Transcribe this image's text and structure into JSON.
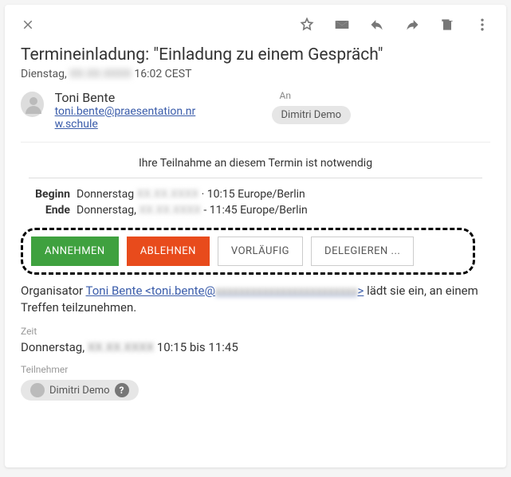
{
  "subject": "Termineinladung: \"Einladung zu einem Gespräch\"",
  "date_prefix": "Dienstag, ",
  "date_hidden": "XX.XX.XXXX",
  "date_suffix": " 16:02 CEST",
  "sender": {
    "name": "Toni Bente",
    "email": "toni.bente@prae­sentation.nrw.schule"
  },
  "to_label": "An",
  "recipient": "Dimitri Demo",
  "participation_note": "Ihre Teilnahme an diesem Termin ist notwendig",
  "times": {
    "begin_label": "Beginn",
    "begin_prefix": "Donnerstag ",
    "begin_hidden": "XX.XX.XXXX",
    "begin_suffix": " · 10:15 Europe/Berlin",
    "end_label": "Ende",
    "end_prefix": "Donnerstag, ",
    "end_hidden": "XX.XX.XXXX",
    "end_suffix": " - 11:45 Europe/Berlin"
  },
  "actions": {
    "accept": "ANNEHMEN",
    "decline": "ABLEHNEN",
    "tentative": "VORLÄUFIG",
    "delegate": "DELEGIEREN ..."
  },
  "organizer": {
    "prefix": "Organisator ",
    "link_text": "Toni Bente <toni.bente@",
    "link_hidden": "xxxxxxxxxxxxxxxxxxxxxxxx",
    "link_end": ">",
    "suffix": " lädt sie ein, an einem Treffen teilzunehmen."
  },
  "section_time_label": "Zeit",
  "time_detail_prefix": "Donnerstag, ",
  "time_detail_hidden": "XX.XX.XXXX",
  "time_detail_suffix": " 10:15 bis 11:45",
  "section_participants_label": "Teilnehmer",
  "participant": "Dimitri Demo"
}
